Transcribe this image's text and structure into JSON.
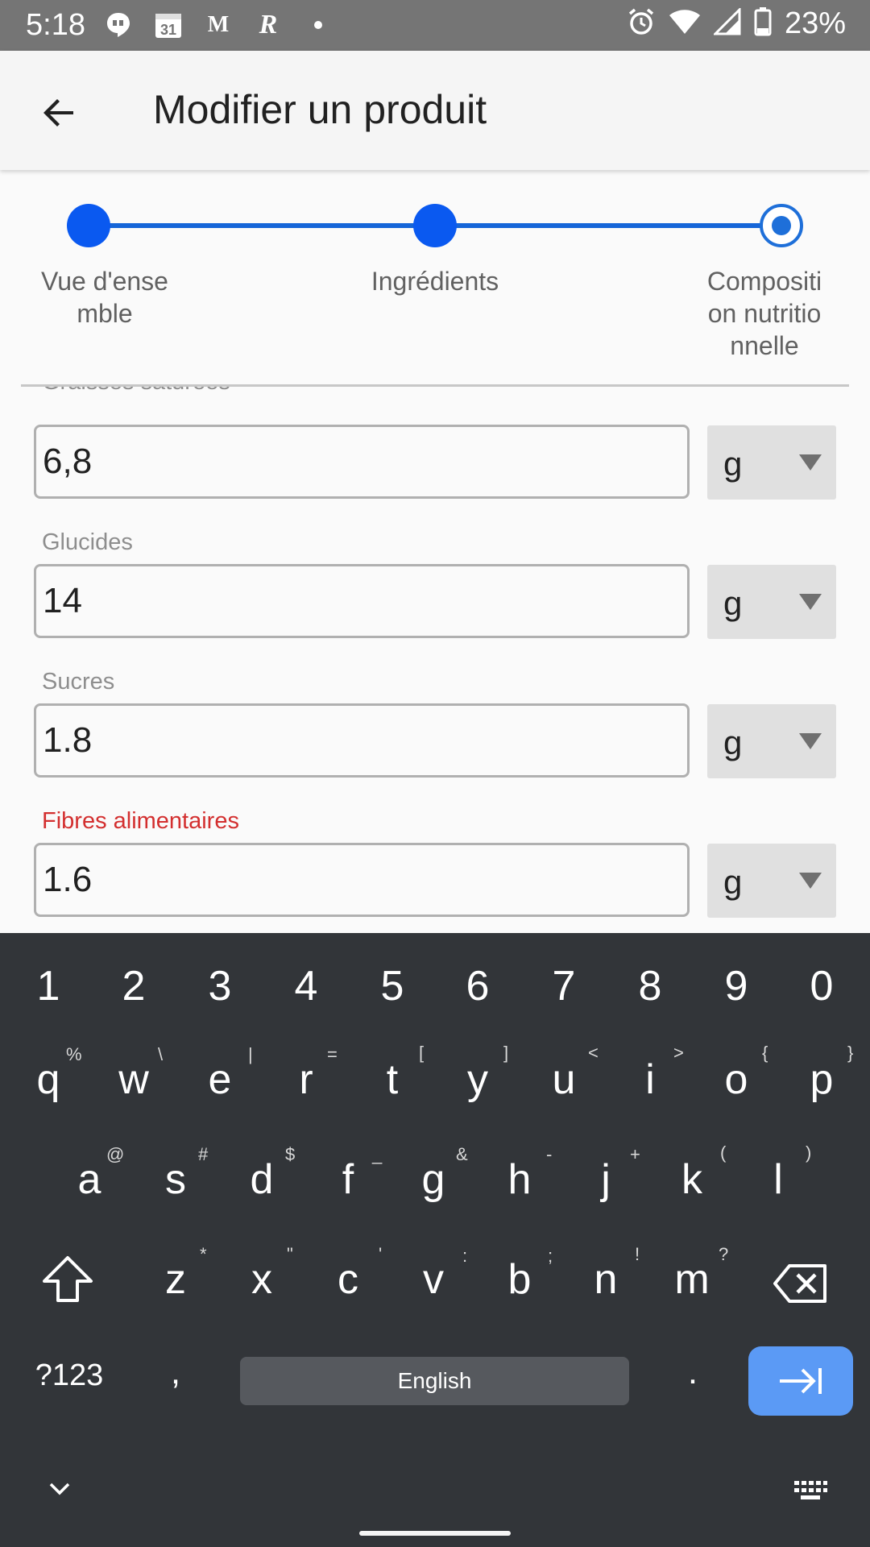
{
  "status_bar": {
    "time": "5:18",
    "left_icons": [
      "hangouts-icon",
      "calendar-icon",
      "gmail-icon",
      "r-app-icon",
      "dot-icon"
    ],
    "calendar_day": "31",
    "gmail_letter": "M",
    "r_letter": "R",
    "battery": "23%"
  },
  "app_bar": {
    "title": "Modifier un produit"
  },
  "stepper": {
    "steps": [
      {
        "label": "Vue d'ense mble",
        "state": "done"
      },
      {
        "label": "Ingrédients",
        "state": "done"
      },
      {
        "label": "Compositi on nutritio nnelle",
        "state": "current"
      }
    ]
  },
  "form": {
    "fields": [
      {
        "label": "Graisses saturées",
        "value": "6,8",
        "unit": "g",
        "error": false
      },
      {
        "label": "Glucides",
        "value": "14",
        "unit": "g",
        "error": false
      },
      {
        "label": "Sucres",
        "value": "1.8",
        "unit": "g",
        "error": false
      },
      {
        "label": "Fibres alimentaires",
        "value": "1.6",
        "unit": "g",
        "error": true
      }
    ],
    "error_color": "#d32f2f"
  },
  "keyboard": {
    "numbers": [
      "1",
      "2",
      "3",
      "4",
      "5",
      "6",
      "7",
      "8",
      "9",
      "0"
    ],
    "row1": [
      "q",
      "w",
      "e",
      "r",
      "t",
      "y",
      "u",
      "i",
      "o",
      "p"
    ],
    "row1_hints": [
      "%",
      "\\",
      "|",
      "=",
      "[",
      "]",
      "<",
      ">",
      "{",
      "}"
    ],
    "row2": [
      "a",
      "s",
      "d",
      "f",
      "g",
      "h",
      "j",
      "k",
      "l"
    ],
    "row2_hints": [
      "@",
      "#",
      "$",
      "_",
      "&",
      "-",
      "+",
      "(",
      ")"
    ],
    "row3": [
      "z",
      "x",
      "c",
      "v",
      "b",
      "n",
      "m"
    ],
    "row3_hints": [
      "*",
      "\"",
      "'",
      ":",
      ";",
      "!",
      "?"
    ],
    "symbols_label": "?123",
    "comma": ",",
    "space_label": "English",
    "period": ".",
    "accent_color": "#5b9af5"
  }
}
